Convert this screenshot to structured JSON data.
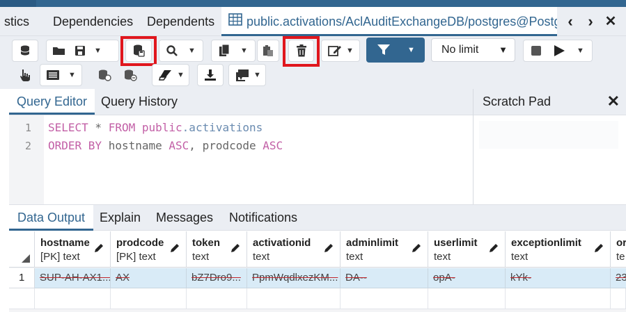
{
  "tabs": [
    {
      "label": "stics"
    },
    {
      "label": "Dependencies"
    },
    {
      "label": "Dependents"
    },
    {
      "label": "public.activations/AclAuditExchangeDB/postgres@Postg",
      "active": true
    }
  ],
  "toolbar": {
    "limit_select": "No limit",
    "icons": [
      "open-database-icon",
      "open-folder-icon",
      "save-icon",
      "save-data-icon",
      "find-icon",
      "copy-icon",
      "paste-icon",
      "delete-icon",
      "edit-icon",
      "filter-icon",
      "stop-icon",
      "execute-icon",
      "explain-icon",
      "explain-analyze-icon",
      "commit-icon",
      "rollback-icon",
      "clear-icon",
      "download-icon",
      "macros-icon"
    ]
  },
  "editor": {
    "tabs": [
      "Query Editor",
      "Query History"
    ],
    "line_numbers": [
      "1",
      "2"
    ],
    "line1": {
      "kw1": "SELECT",
      "star": " * ",
      "kw2": "FROM",
      "schema": " public",
      "table": ".activations"
    },
    "line2": {
      "kw1": "ORDER BY",
      "rest1": " hostname ",
      "kw2": "ASC",
      "rest2": ", prodcode ",
      "kw3": "ASC"
    }
  },
  "scratch": {
    "title": "Scratch Pad",
    "close": "✕"
  },
  "output": {
    "tabs": [
      "Data Output",
      "Explain",
      "Messages",
      "Notifications"
    ],
    "columns": [
      {
        "name": "hostname",
        "type": "[PK] text"
      },
      {
        "name": "prodcode",
        "type": "[PK] text"
      },
      {
        "name": "token",
        "type": "text"
      },
      {
        "name": "activationid",
        "type": "text"
      },
      {
        "name": "adminlimit",
        "type": "text"
      },
      {
        "name": "userlimit",
        "type": "text"
      },
      {
        "name": "exceptionlimit",
        "type": "text"
      },
      {
        "name": "or",
        "type": "te"
      }
    ],
    "rows": [
      {
        "num": "1",
        "cells": [
          "SUP-AH-AX1...",
          "AX",
          "bZ7Dro9...",
          "PpmWqdlxezKM...",
          "DA--",
          "opA-",
          "kYk-",
          "23"
        ]
      }
    ]
  },
  "colors": {
    "accent": "#326690",
    "highlight": "#e0161d",
    "row_selected": "#d9ebf7"
  }
}
